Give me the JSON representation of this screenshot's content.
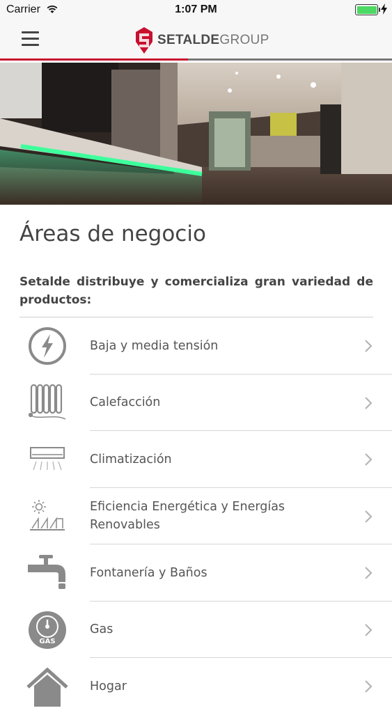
{
  "status_bar": {
    "carrier": "Carrier",
    "time": "1:07 PM",
    "battery_level": 1.0
  },
  "nav": {
    "menu_icon": "hamburger-icon",
    "logo_bold": "SETALDE",
    "logo_light": "GROUP",
    "accent_color": "#c8102e"
  },
  "main": {
    "title": "Áreas de negocio",
    "intro": "Setalde distribuye y comercializa gran variedad de productos:",
    "items": [
      {
        "label": "Baja y media tensión",
        "icon": "lightning-icon"
      },
      {
        "label": "Calefacción",
        "icon": "radiator-icon"
      },
      {
        "label": "Climatización",
        "icon": "air-conditioner-icon"
      },
      {
        "label": "Eficiencia Energética y  Energías Renovables",
        "icon": "solar-energy-icon"
      },
      {
        "label": "Fontanería y Baños",
        "icon": "faucet-icon"
      },
      {
        "label": "Gas",
        "icon": "gas-meter-icon",
        "icon_text": "GAS"
      },
      {
        "label": "Hogar",
        "icon": "house-icon"
      }
    ]
  }
}
